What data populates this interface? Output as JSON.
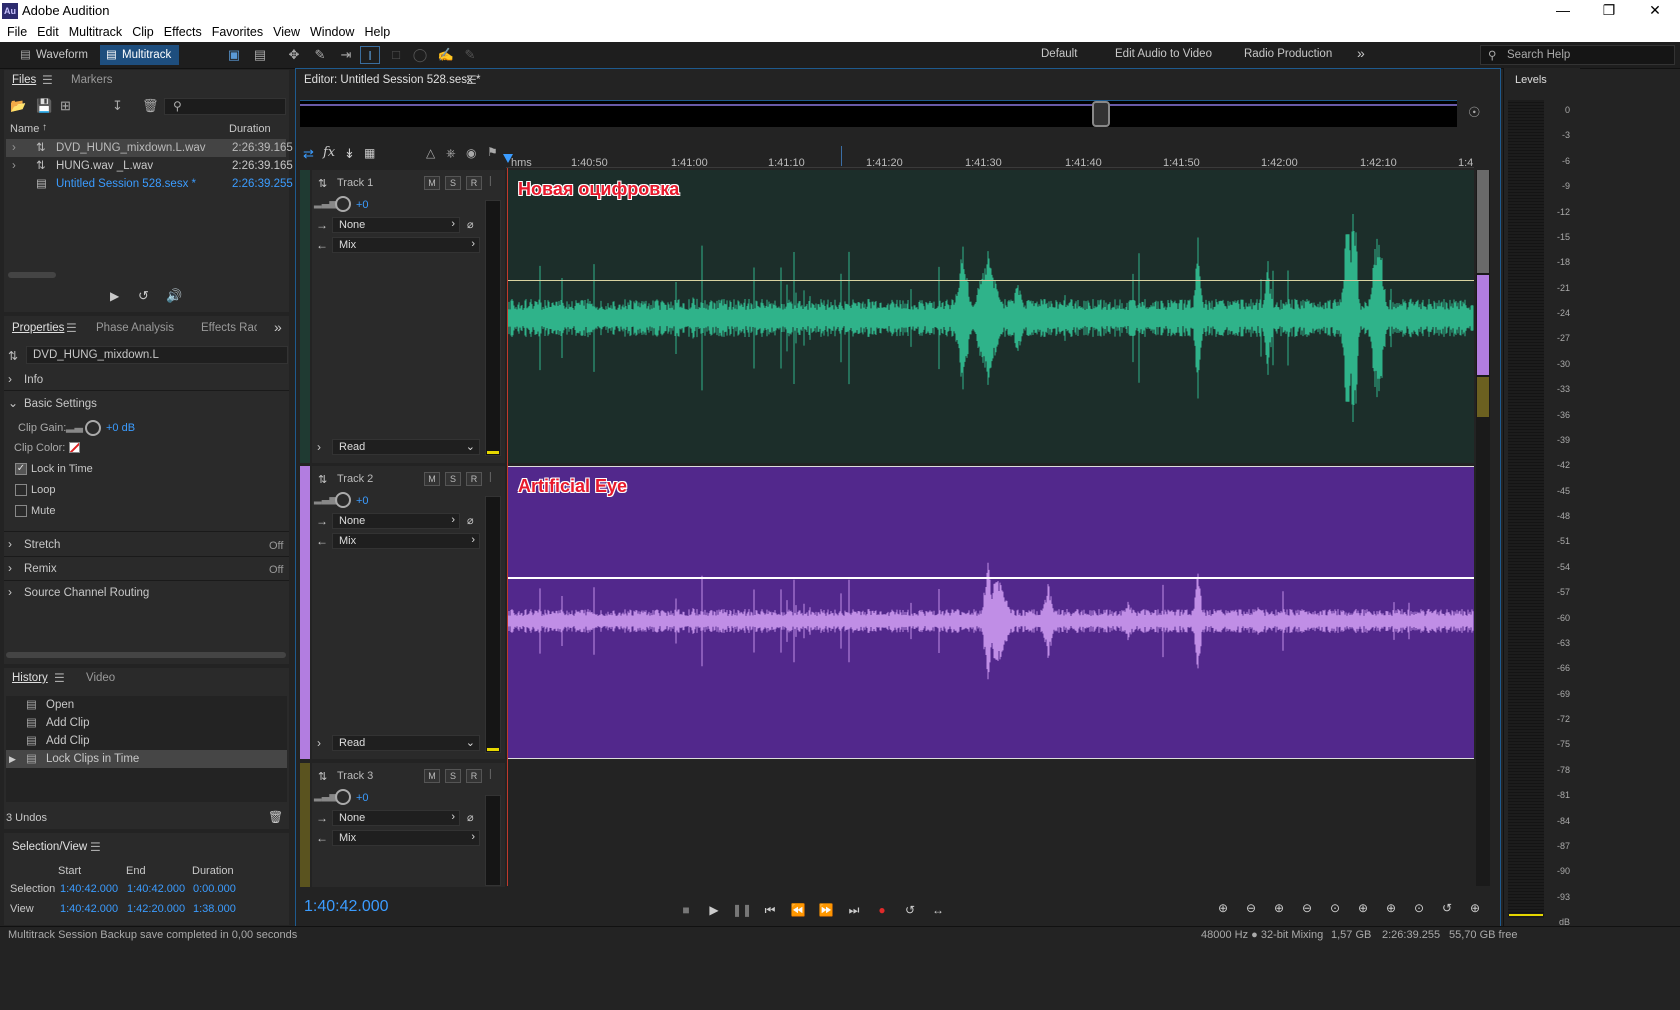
{
  "app": {
    "title": "Adobe Audition",
    "logo": "Au"
  },
  "window_controls": [
    "minimize-icon",
    "restore-icon",
    "close-icon"
  ],
  "menu": [
    "File",
    "Edit",
    "Multitrack",
    "Clip",
    "Effects",
    "Favorites",
    "View",
    "Window",
    "Help"
  ],
  "toolbar": {
    "waveform": "Waveform",
    "multitrack": "Multitrack",
    "workspaces": [
      "Default",
      "Edit Audio to Video",
      "Radio Production"
    ],
    "search_placeholder": "Search Help"
  },
  "files": {
    "tab_files": "Files",
    "tab_markers": "Markers",
    "col_name": "Name",
    "col_duration": "Duration",
    "items": [
      {
        "name": "DVD_HUNG_mixdown.L.wav",
        "duration": "2:26:39.165"
      },
      {
        "name": "HUNG.wav _L.wav",
        "duration": "2:26:39.165"
      },
      {
        "name": "Untitled Session 528.sesx *",
        "duration": "2:26:39.255"
      }
    ]
  },
  "properties": {
    "tabs": [
      "Properties",
      "Phase Analysis",
      "Effects Rack"
    ],
    "clip_name": "DVD_HUNG_mixdown.L",
    "info": "Info",
    "basic_settings": "Basic Settings",
    "clip_gain_label": "Clip Gain:",
    "clip_gain_value": "+0 dB",
    "clip_color_label": "Clip Color:",
    "lock_in_time": "Lock in Time",
    "loop": "Loop",
    "mute": "Mute",
    "stretch": "Stretch",
    "stretch_value": "Off",
    "remix": "Remix",
    "remix_value": "Off",
    "source_channel_routing": "Source Channel Routing"
  },
  "history": {
    "tab_history": "History",
    "tab_video": "Video",
    "items": [
      "Open",
      "Add Clip",
      "Add Clip",
      "Lock Clips in Time"
    ],
    "undos": "3 Undos"
  },
  "selection_view": {
    "title": "Selection/View",
    "col_start": "Start",
    "col_end": "End",
    "col_duration": "Duration",
    "selection_label": "Selection",
    "selection": [
      "1:40:42.000",
      "1:40:42.000",
      "0:00.000"
    ],
    "view_label": "View",
    "view": [
      "1:40:42.000",
      "1:42:20.000",
      "1:38.000"
    ]
  },
  "editor": {
    "title": "Editor: Untitled Session 528.sesx *",
    "ruler_unit": "hms",
    "ruler_ticks": [
      "1:40:50",
      "1:41:00",
      "1:41:10",
      "1:41:20",
      "1:41:30",
      "1:41:40",
      "1:41:50",
      "1:42:00",
      "1:42:10",
      "1:4"
    ],
    "time_display": "1:40:42.000"
  },
  "tracks": [
    {
      "name": "Track 1",
      "volume": "+0",
      "input": "None",
      "output": "Mix",
      "automation": "Read",
      "clip_label": "Новая оцифровка",
      "color": "#2fb38a"
    },
    {
      "name": "Track 2",
      "volume": "+0",
      "input": "None",
      "output": "Mix",
      "automation": "Read",
      "clip_label": "Artificial Eye",
      "color": "#c08ee6"
    },
    {
      "name": "Track 3",
      "volume": "+0",
      "input": "None",
      "output": "Mix",
      "automation": "",
      "clip_label": "",
      "color": "#6b6020"
    }
  ],
  "track_buttons": [
    "M",
    "S",
    "R"
  ],
  "levels": {
    "title": "Levels",
    "scale": [
      "0",
      "-3",
      "-6",
      "-9",
      "-12",
      "-15",
      "-18",
      "-21",
      "-24",
      "-27",
      "-30",
      "-33",
      "-36",
      "-39",
      "-42",
      "-45",
      "-48",
      "-51",
      "-54",
      "-57",
      "-60",
      "-63",
      "-66",
      "-69",
      "-72",
      "-75",
      "-78",
      "-81",
      "-84",
      "-87",
      "-90",
      "-93",
      "dB"
    ]
  },
  "status": {
    "message": "Multitrack Session Backup save completed in 0,00 seconds",
    "sample_rate": "48000 Hz ● 32-bit Mixing",
    "memory": "1,57 GB",
    "duration": "2:26:39.255",
    "free": "55,70 GB free"
  }
}
